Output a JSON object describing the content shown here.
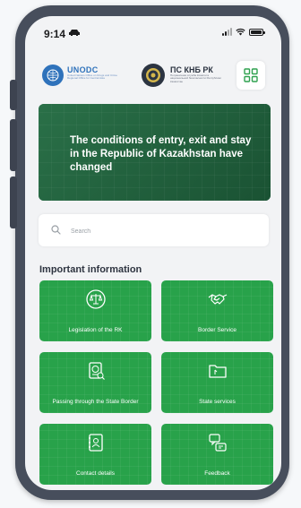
{
  "status_bar": {
    "time": "9:14"
  },
  "header": {
    "unodc": {
      "name": "UNODC",
      "subtitle": "United Nations Office on Drugs and Crime Regional Office for Central Asia"
    },
    "psknb": {
      "name": "ПС КНБ РК",
      "subtitle": "Пограничная служба Комитета национальной безопасности Республики Казахстан"
    }
  },
  "banner": {
    "text": "The conditions of entry, exit and stay in the Republic of Kazakhstan have changed"
  },
  "search": {
    "placeholder": "Search",
    "value": ""
  },
  "section": {
    "title": "Important information"
  },
  "tiles": [
    {
      "label": "Legislation of the RK",
      "icon": "scales-icon"
    },
    {
      "label": "Border Service",
      "icon": "handshake-icon"
    },
    {
      "label": "Passing through the State Border",
      "icon": "passport-icon"
    },
    {
      "label": "State services",
      "icon": "folder-icon"
    },
    {
      "label": "Contact details",
      "icon": "contact-book-icon"
    },
    {
      "label": "Feedback",
      "icon": "feedback-icon"
    }
  ],
  "colors": {
    "tile_green": "#28a24a",
    "banner_green": "#1e5d3d",
    "brand_blue": "#2f72bb"
  }
}
